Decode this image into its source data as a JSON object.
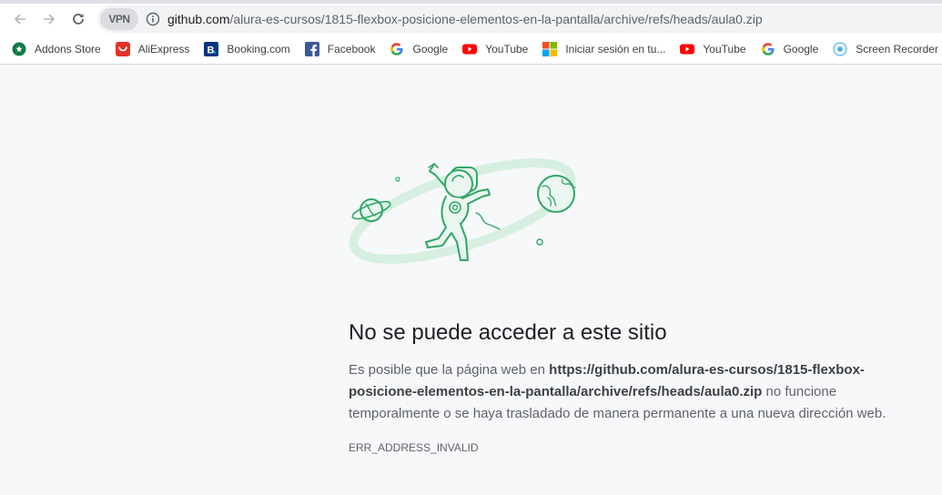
{
  "browser": {
    "vpn_label": "VPN",
    "url_host": "github.com",
    "url_path": "/alura-es-cursos/1815-flexbox-posicione-elementos-en-la-pantalla/archive/refs/heads/aula0.zip"
  },
  "bookmarks": [
    {
      "label": "Addons Store",
      "icon": "addons-store-icon"
    },
    {
      "label": "AliExpress",
      "icon": "aliexpress-icon"
    },
    {
      "label": "Booking.com",
      "icon": "booking-icon"
    },
    {
      "label": "Facebook",
      "icon": "facebook-icon"
    },
    {
      "label": "Google",
      "icon": "google-icon"
    },
    {
      "label": "YouTube",
      "icon": "youtube-icon"
    },
    {
      "label": "Iniciar sesión en tu...",
      "icon": "microsoft-icon"
    },
    {
      "label": "YouTube",
      "icon": "youtube-icon"
    },
    {
      "label": "Google",
      "icon": "google-icon"
    },
    {
      "label": "Screen Recorder",
      "icon": "screen-recorder-icon"
    }
  ],
  "error": {
    "title": "No se puede acceder a este sitio",
    "desc_prefix": "Es posible que la página web en ",
    "desc_url_line1": "https://github.com/alura-es-cursos/1815-flexbox-",
    "desc_url_line2": "posicione-elementos-en-la-pantalla/archive/refs/heads/aula0.zip",
    "desc_suffix_1": " no funcione",
    "desc_suffix_2": "temporalmente o se haya trasladado de manera permanente a una nueva dirección web.",
    "code": "ERR_ADDRESS_INVALID"
  },
  "colors": {
    "illustration_green": "#2fa866",
    "page_bg": "#f7f8fa"
  }
}
